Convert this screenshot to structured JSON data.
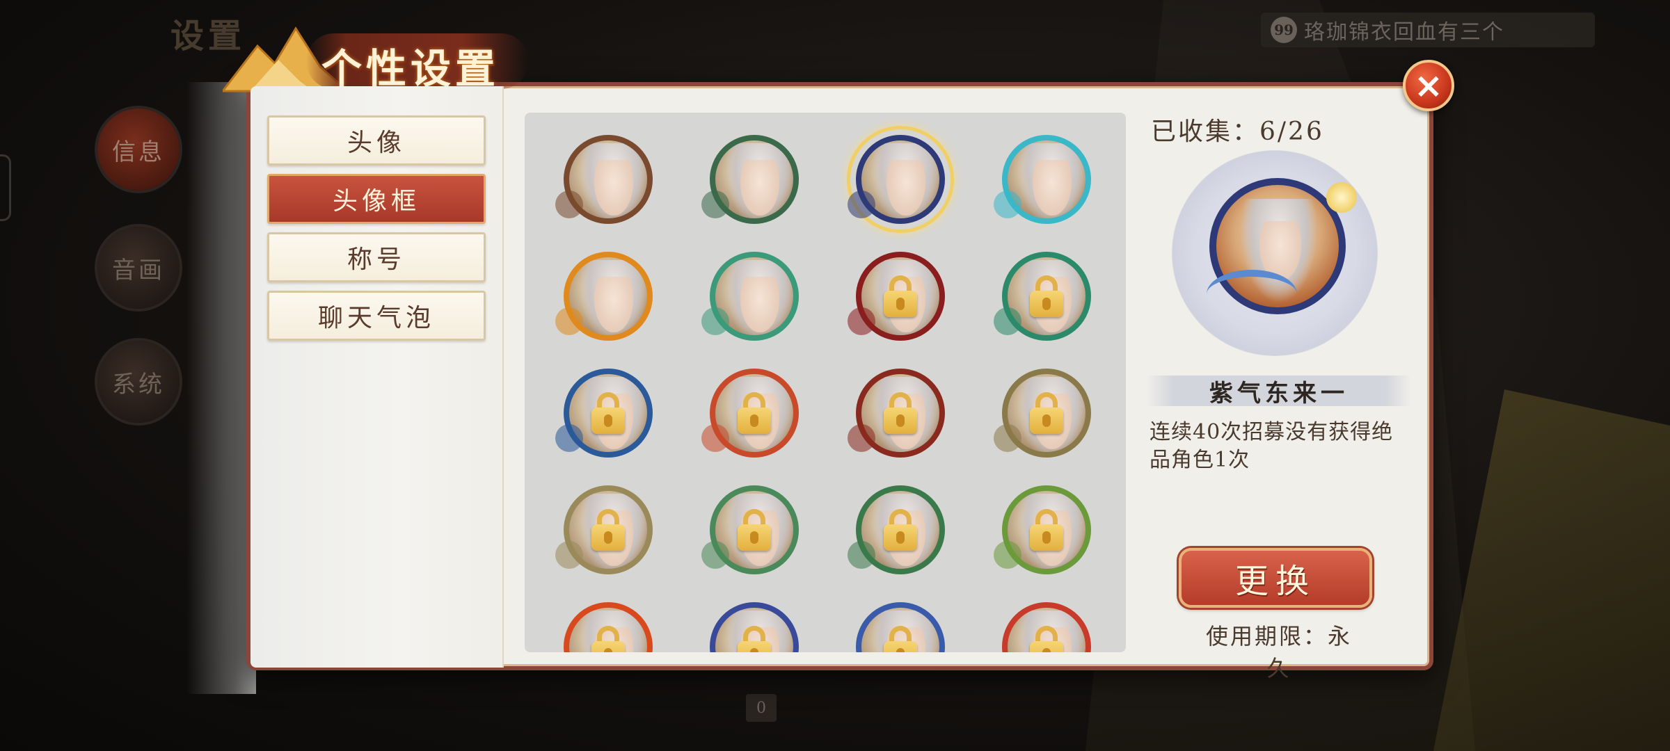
{
  "background": {
    "settings_title": "设置",
    "side_buttons": [
      {
        "label": "信息",
        "active": true
      },
      {
        "label": "音画",
        "active": false
      },
      {
        "label": "系统",
        "active": false
      }
    ],
    "chat_icon_text": "99",
    "chat_message": "珞珈锦衣回血有三个",
    "counter": "0"
  },
  "dialog": {
    "title": "个性设置",
    "close_icon": "close-icon",
    "tabs": [
      {
        "label": "头像",
        "active": false
      },
      {
        "label": "头像框",
        "active": true
      },
      {
        "label": "称号",
        "active": false
      },
      {
        "label": "聊天气泡",
        "active": false
      }
    ]
  },
  "frames": [
    {
      "locked": false,
      "selected": false,
      "ring_color": "#7a4a2e"
    },
    {
      "locked": false,
      "selected": false,
      "ring_color": "#3a6a4a"
    },
    {
      "locked": false,
      "selected": true,
      "ring_color": "#2e3a78"
    },
    {
      "locked": false,
      "selected": false,
      "ring_color": "#3ab8c8"
    },
    {
      "locked": false,
      "selected": false,
      "ring_color": "#e08a1e"
    },
    {
      "locked": false,
      "selected": false,
      "ring_color": "#3a9a7a"
    },
    {
      "locked": true,
      "selected": false,
      "ring_color": "#8a1e1e"
    },
    {
      "locked": true,
      "selected": false,
      "ring_color": "#2a8a6a"
    },
    {
      "locked": true,
      "selected": false,
      "ring_color": "#2a5a9a"
    },
    {
      "locked": true,
      "selected": false,
      "ring_color": "#c84a2a"
    },
    {
      "locked": true,
      "selected": false,
      "ring_color": "#8a2a1e"
    },
    {
      "locked": true,
      "selected": false,
      "ring_color": "#8a7a4a"
    },
    {
      "locked": true,
      "selected": false,
      "ring_color": "#9a8a5a"
    },
    {
      "locked": true,
      "selected": false,
      "ring_color": "#4a8a5a"
    },
    {
      "locked": true,
      "selected": false,
      "ring_color": "#3a7a4a"
    },
    {
      "locked": true,
      "selected": false,
      "ring_color": "#6a9a3a"
    },
    {
      "locked": true,
      "selected": false,
      "ring_color": "#d84a1e"
    },
    {
      "locked": true,
      "selected": false,
      "ring_color": "#3a4a9a"
    },
    {
      "locked": true,
      "selected": false,
      "ring_color": "#3a5aaa"
    },
    {
      "locked": true,
      "selected": false,
      "ring_color": "#c83a2a"
    }
  ],
  "detail": {
    "collected_label": "已收集：6/26",
    "frame_name": "紫气东来一",
    "description": "连续40次招募没有获得绝品角色1次",
    "change_button": "更换",
    "duration": "使用期限：永久"
  },
  "colors": {
    "dialog_border": "#8a4638",
    "active_tab": "#b8442f",
    "button_red": "#c84a34",
    "panel_bg": "#f1efea",
    "grid_bg": "#d6d6d5",
    "lock_gold": "#e3b03e"
  }
}
